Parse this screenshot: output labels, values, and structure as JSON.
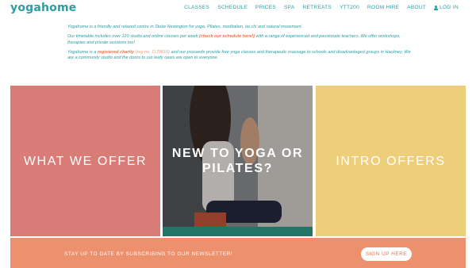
{
  "header": {
    "logo": "yogahome",
    "nav": [
      "CLASSES",
      "SCHEDULE",
      "PRICES",
      "SPA",
      "RETREATS",
      "YTT200",
      "ROOM HIRE",
      "ABOUT"
    ],
    "login": "LOG IN"
  },
  "intro": {
    "p1": "Yogahome is a friendly and relaxed centre in Stoke Newington for yoga, Pilates, meditation, tai chi and natural movement.",
    "p2_a": "Our timetable includes over 120 studio and online classes per week ",
    "p2_link": "(check our schedule here!)",
    "p2_b": " with a range of experienced and passionate teachers. We offer workshops, therapies and private sessions too!",
    "p3_a": "Yogahome is a ",
    "p3_link": "registered charity",
    "p3_reg": " (reg no. 1170810)",
    "p3_b": " and our proceeds provide free yoga classes and therapeutic massage to schools and disadvantaged groups in Hackney. We are a community studio and the doors to our leafy oasis are open to everyone."
  },
  "tiles": {
    "offer": "WHAT WE OFFER",
    "new": "NEW TO YOGA OR PILATES?",
    "intro_offers": "INTRO OFFERS"
  },
  "newsletter": {
    "text": "STAY UP TO DATE BY SUBSCRIBING TO OUR NEWSLETTER!",
    "button": "SIGN UP HERE"
  },
  "colors": {
    "brand_teal": "#2a9ea3",
    "accent_orange": "#e8734b",
    "tile_pink": "#d97b77",
    "tile_yellow": "#edce7a",
    "newsletter_bg": "#ec906d"
  }
}
